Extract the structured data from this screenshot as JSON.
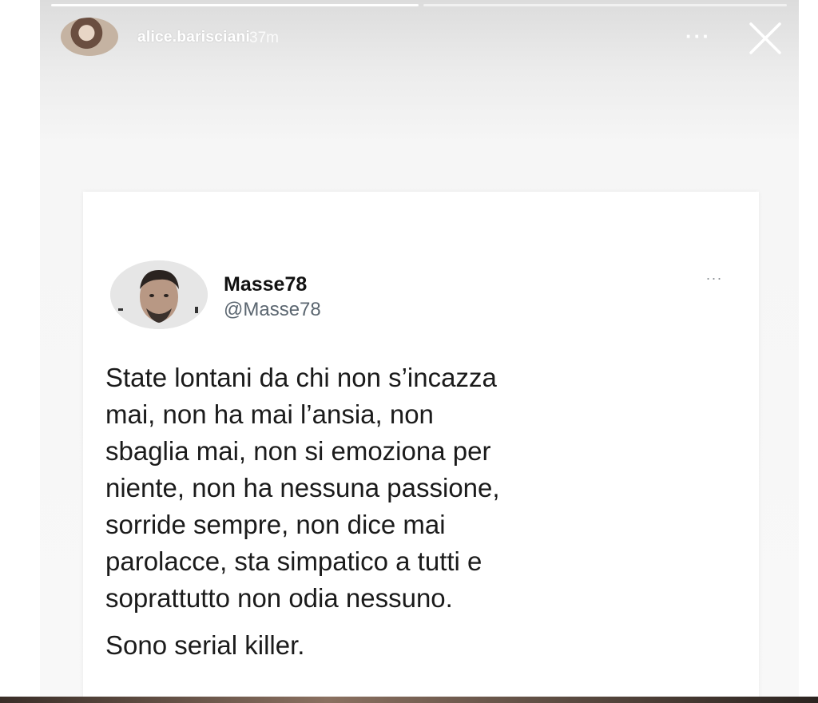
{
  "story": {
    "username": "alice.barisciani",
    "timestamp": "37m",
    "more_label": "···",
    "close_icon": "close-icon"
  },
  "tweet": {
    "display_name": "Masse78",
    "handle": "@Masse78",
    "more_label": "···",
    "body": "State lontani da chi non s’incazza\nmai, non ha mai l’ansia, non\nsbaglia mai, non si emoziona per\nniente, non ha nessuna passione,\nsorride sempre, non dice mai\nparolacce, sta simpatico a tutti e\nsoprattutto non odia nessuno.",
    "closing_line": "Sono serial killer."
  },
  "colors": {
    "story_background": "#f4f4f4",
    "card_background": "#ffffff",
    "text_primary": "#1b1b1b",
    "text_secondary": "#5b6670"
  }
}
